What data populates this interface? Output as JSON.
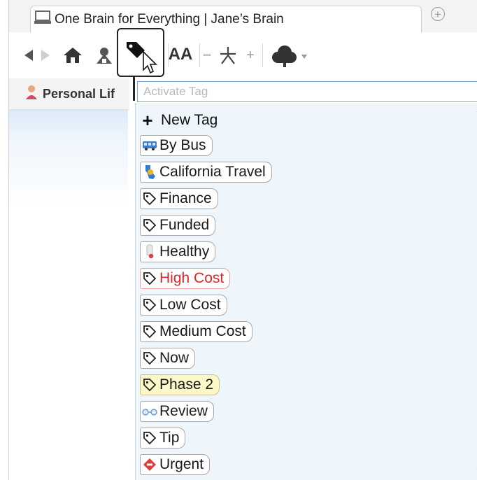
{
  "window": {
    "tab_title": "One Brain for Everything | Jane’s Brain"
  },
  "toolbar": {
    "back_icon": "back-arrow-icon",
    "forward_icon": "forward-arrow-icon",
    "home_icon": "home-icon",
    "tag_icon": "tag-icon",
    "font_label": "AA",
    "minus_label": "−",
    "plus_label": "+"
  },
  "sidebar": {
    "tab_label": "Personal Lif"
  },
  "tag_menu": {
    "search_placeholder": "Activate Tag",
    "new_tag_label": "New Tag",
    "tags": [
      {
        "label": "By Bus",
        "icon": "bus-icon",
        "style": "normal"
      },
      {
        "label": "California Travel",
        "icon": "california-icon",
        "style": "normal"
      },
      {
        "label": "Finance",
        "icon": "tag-outline-icon",
        "style": "normal"
      },
      {
        "label": "Funded",
        "icon": "tag-outline-icon",
        "style": "normal"
      },
      {
        "label": "Healthy",
        "icon": "thermometer-icon",
        "style": "normal"
      },
      {
        "label": "High Cost",
        "icon": "tag-outline-icon",
        "style": "red"
      },
      {
        "label": "Low Cost",
        "icon": "tag-outline-icon",
        "style": "normal"
      },
      {
        "label": "Medium Cost",
        "icon": "tag-outline-icon",
        "style": "normal"
      },
      {
        "label": "Now",
        "icon": "tag-outline-icon",
        "style": "normal"
      },
      {
        "label": "Phase 2",
        "icon": "tag-outline-icon",
        "style": "yellow"
      },
      {
        "label": "Review",
        "icon": "glasses-icon",
        "style": "normal"
      },
      {
        "label": "Tip",
        "icon": "tag-outline-icon",
        "style": "normal"
      },
      {
        "label": "Urgent",
        "icon": "urgent-diamond-icon",
        "style": "normal"
      }
    ]
  },
  "colors": {
    "red_tag_text": "#e0242c",
    "yellow_tag_bg": "#fbf7c8",
    "dropdown_bg": "#eef6fc",
    "input_border": "#7aa6d6"
  }
}
